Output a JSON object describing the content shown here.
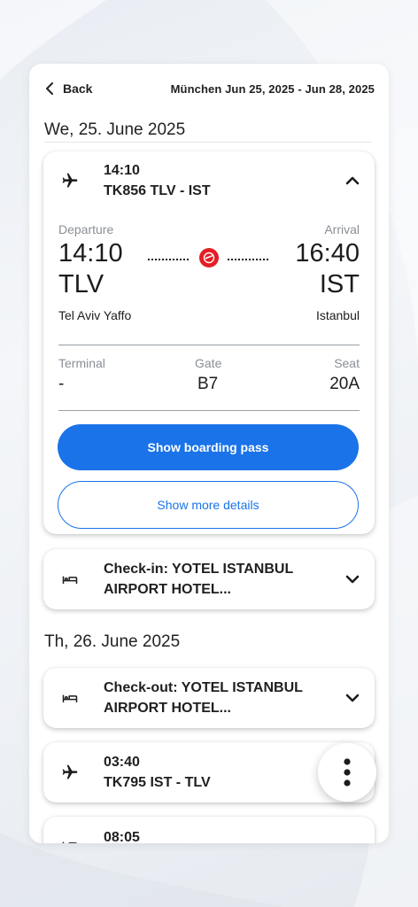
{
  "header": {
    "back_label": "Back",
    "trip_title": "München Jun 25, 2025 - Jun 28, 2025"
  },
  "days": [
    {
      "heading": "We, 25. June 2025"
    },
    {
      "heading": "Th, 26. June 2025"
    }
  ],
  "flight1": {
    "time": "14:10",
    "flight": "TK856 TLV - IST",
    "departure_label": "Departure",
    "arrival_label": "Arrival",
    "dep_time": "14:10",
    "arr_time": "16:40",
    "dep_code": "TLV",
    "arr_code": "IST",
    "dep_city": "Tel Aviv Yaffo",
    "arr_city": "Istanbul",
    "terminal_label": "Terminal",
    "gate_label": "Gate",
    "seat_label": "Seat",
    "terminal": "-",
    "gate": "B7",
    "seat": "20A",
    "boarding_pass_label": "Show boarding pass",
    "more_details_label": "Show more details",
    "airline_logo": "turkish-airlines-logo",
    "brand_color": "#e31e24"
  },
  "hotel_checkin": {
    "line1": "Check-in: YOTEL ISTANBUL",
    "line2": "AIRPORT HOTEL..."
  },
  "hotel_checkout": {
    "line1": "Check-out: YOTEL ISTANBUL",
    "line2": "AIRPORT HOTEL..."
  },
  "flight2": {
    "time": "03:40",
    "flight": "TK795 IST - TLV"
  },
  "next_item": {
    "time": "08:05"
  },
  "colors": {
    "accent": "#1a73e8"
  },
  "icons": [
    "chevron-left-icon",
    "airplane-icon",
    "chevron-up-icon",
    "bed-icon",
    "chevron-down-icon",
    "more-vert-icon"
  ]
}
